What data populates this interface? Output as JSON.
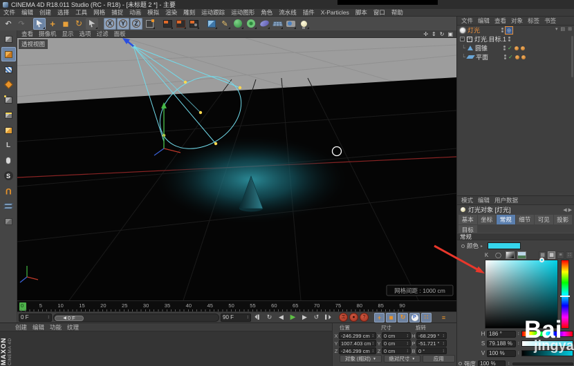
{
  "window": {
    "title": "CINEMA 4D R18.011 Studio (RC - R18) - [未标题 2 *] - 主要"
  },
  "menubar": [
    "文件",
    "编辑",
    "创建",
    "选择",
    "工具",
    "网格",
    "捕捉",
    "动画",
    "模拟",
    "渲染",
    "雕刻",
    "运动跟踪",
    "运动图形",
    "角色",
    "流水线",
    "插件",
    "X-Particles",
    "脚本",
    "窗口",
    "帮助"
  ],
  "toolbar": {
    "axis_x": "X",
    "axis_y": "Y",
    "axis_z": "Z"
  },
  "left_toolbar": {
    "solo_letter": "S",
    "axis_letter": "L"
  },
  "viewport": {
    "menus": [
      "查看",
      "摄像机",
      "显示",
      "选项",
      "过滤",
      "面板"
    ],
    "view_label": "透视视图",
    "grid_spacing_label": "网格间距 : 1000 cm"
  },
  "timeline": {
    "ticks": [
      "0",
      "5",
      "10",
      "15",
      "20",
      "25",
      "30",
      "35",
      "40",
      "45",
      "50",
      "55",
      "60",
      "65",
      "70",
      "75",
      "80",
      "85",
      "90"
    ],
    "frame_field": "0 F",
    "slider_label": "0 F",
    "end_field": "90 F"
  },
  "material_manager": {
    "menus": [
      "创建",
      "编辑",
      "功能",
      "纹理"
    ]
  },
  "branding": {
    "maxon": "MAXON",
    "cinema": "CINEMA 4D"
  },
  "coordinates": {
    "headers": [
      "位置",
      "尺寸",
      "旋转"
    ],
    "row_labels": {
      "x": "X",
      "y": "Y",
      "z": "Z",
      "h": "H",
      "p": "P",
      "b": "B"
    },
    "position": {
      "x": "-246.299 cm",
      "y": "1007.403 cm",
      "z": "-246.299 cm"
    },
    "size": {
      "x": "0 cm",
      "y": "0 cm",
      "z": "0 cm"
    },
    "rotation": {
      "h": "-68.299 °",
      "p": "-51.721 °",
      "b": "0 °"
    },
    "mode_dropdown": "对象 (相对)",
    "size_dropdown": "绝对尺寸",
    "apply_button": "应用"
  },
  "object_manager": {
    "menus": [
      "文件",
      "编辑",
      "查看",
      "对象",
      "标签",
      "书签"
    ],
    "objects": [
      {
        "label": "灯光",
        "selected": true
      },
      {
        "label": "灯光.目标.1",
        "selected": false
      },
      {
        "label": "圆锥",
        "selected": false
      },
      {
        "label": "平面",
        "selected": false
      }
    ]
  },
  "attribute_manager": {
    "menus": [
      "模式",
      "编辑",
      "用户数据"
    ],
    "title": "灯光对象 [灯光]",
    "tabs": [
      "基本",
      "坐标",
      "常规",
      "细节",
      "可见",
      "投影"
    ],
    "tab_row2": "目标",
    "active_tab": "常规",
    "section": "常规",
    "color_label": "颜色",
    "swatch_color": "#36d5ec",
    "kelvin_icon_letter": "K",
    "hsv": {
      "h_label": "H",
      "h_value": "186 °",
      "s_label": "S",
      "s_value": "79.188 %",
      "v_label": "V",
      "v_value": "100 %",
      "hue_degrees": 186,
      "saturation_percent": 79.188,
      "value_percent": 100
    },
    "intensity_label": "强度",
    "intensity_value": "100 %"
  },
  "watermark": {
    "line1": "Bai",
    "line2": "jingya"
  },
  "annotation": {
    "arrow_color": "#e8372b"
  }
}
